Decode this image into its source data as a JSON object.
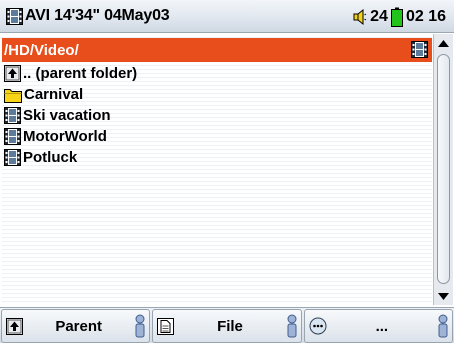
{
  "status": {
    "title": "AVI 14'34\" 04May03",
    "volume": "24",
    "time": "02 16"
  },
  "browser": {
    "path": "/HD/Video/",
    "items": [
      {
        "label": ".. (parent folder)",
        "icon": "parent-folder-icon"
      },
      {
        "label": "Carnival",
        "icon": "folder-icon"
      },
      {
        "label": "Ski vacation",
        "icon": "video-file-icon"
      },
      {
        "label": "MotorWorld",
        "icon": "video-file-icon"
      },
      {
        "label": "Potluck",
        "icon": "video-file-icon"
      }
    ]
  },
  "toolbar": {
    "parent_label": "Parent",
    "file_label": "File",
    "more_label": "..."
  },
  "colors": {
    "path_highlight": "#e84e1b",
    "folder_yellow": "#f6d418",
    "battery_green": "#22c41b"
  }
}
